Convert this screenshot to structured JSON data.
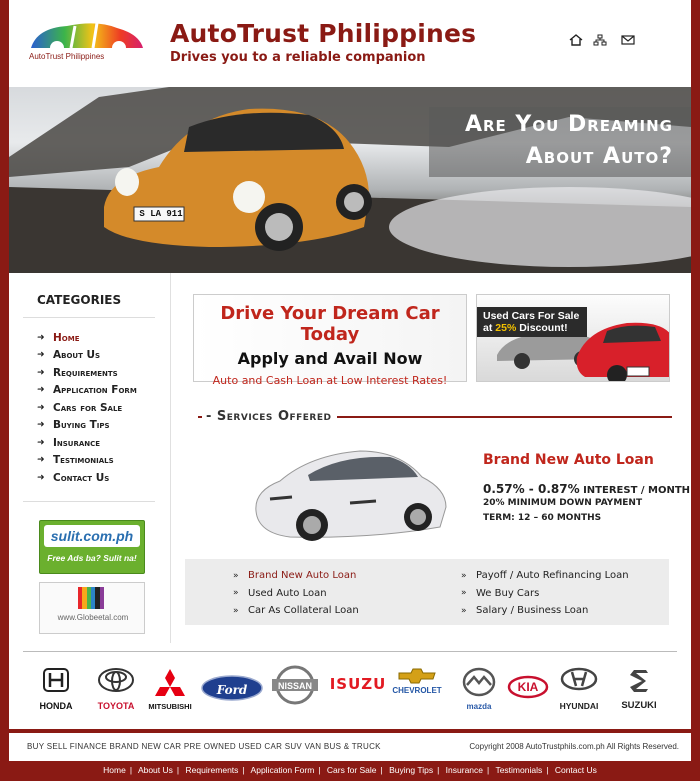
{
  "header": {
    "logo_text": "AutoTrust Philippines",
    "title": "AutoTrust Philippines",
    "tagline": "Drives you to a reliable companion",
    "icons": [
      "home-icon",
      "sitemap-icon",
      "mail-icon"
    ]
  },
  "banner": {
    "line1": "Are You Dreaming",
    "line2": "About Auto?",
    "plate": "S LA 911"
  },
  "sidebar": {
    "title": "CATEGORIES",
    "items": [
      {
        "label": "Home",
        "active": true
      },
      {
        "label": "About Us"
      },
      {
        "label": "Requirements"
      },
      {
        "label": "Application Form"
      },
      {
        "label": "Cars for Sale"
      },
      {
        "label": "Buying Tips"
      },
      {
        "label": "Insurance"
      },
      {
        "label": "Testimonials"
      },
      {
        "label": "Contact Us"
      }
    ],
    "sulit": {
      "name": "sulit.com.ph",
      "tag": "Free Ads ba? Sulit na!"
    },
    "globe": {
      "name": "www.Globeetal.com"
    }
  },
  "promo1": {
    "line1": "Drive Your Dream Car Today",
    "line2": "Apply and Avail Now",
    "line3": "Auto and Cash Loan at Low Interest Rates!"
  },
  "promo2": {
    "line1": "Used Cars For Sale",
    "line2_pre": "at ",
    "discount": "25%",
    "line2_post": " Discount!"
  },
  "services": {
    "title": "Services Offered",
    "feature": {
      "title": "Brand New Auto Loan",
      "rate": "0.57% - 0.87%",
      "rate_suffix": " INTEREST / MONTH",
      "down_payment": "20% MINIMUM DOWN PAYMENT",
      "term": "TERM: 12 – 60 MONTHS"
    },
    "left": [
      "Brand New Auto Loan",
      "Used Auto Loan",
      "Car As Collateral Loan"
    ],
    "right": [
      "Payoff / Auto Refinancing Loan",
      "We Buy Cars",
      "Salary / Business Loan"
    ]
  },
  "brands": [
    "HONDA",
    "TOYOTA",
    "MITSUBISHI",
    "Ford",
    "NISSAN",
    "ISUZU",
    "CHEVROLET",
    "mazda",
    "KIA",
    "HYUNDAI",
    "SUZUKI"
  ],
  "footer": {
    "left": "BUY SELL FINANCE BRAND NEW CAR PRE OWNED USED CAR SUV VAN BUS & TRUCK",
    "right": "Copyright 2008 AutoTrustphils.com.ph All Rights Reserved."
  },
  "bottom_nav": [
    "Home",
    "About Us",
    "Requirements",
    "Application Form",
    "Cars for Sale",
    "Buying Tips",
    "Insurance",
    "Testimonials",
    "Contact Us"
  ],
  "colors": {
    "brand": "#8a1a14",
    "accent_red": "#c0261c"
  }
}
